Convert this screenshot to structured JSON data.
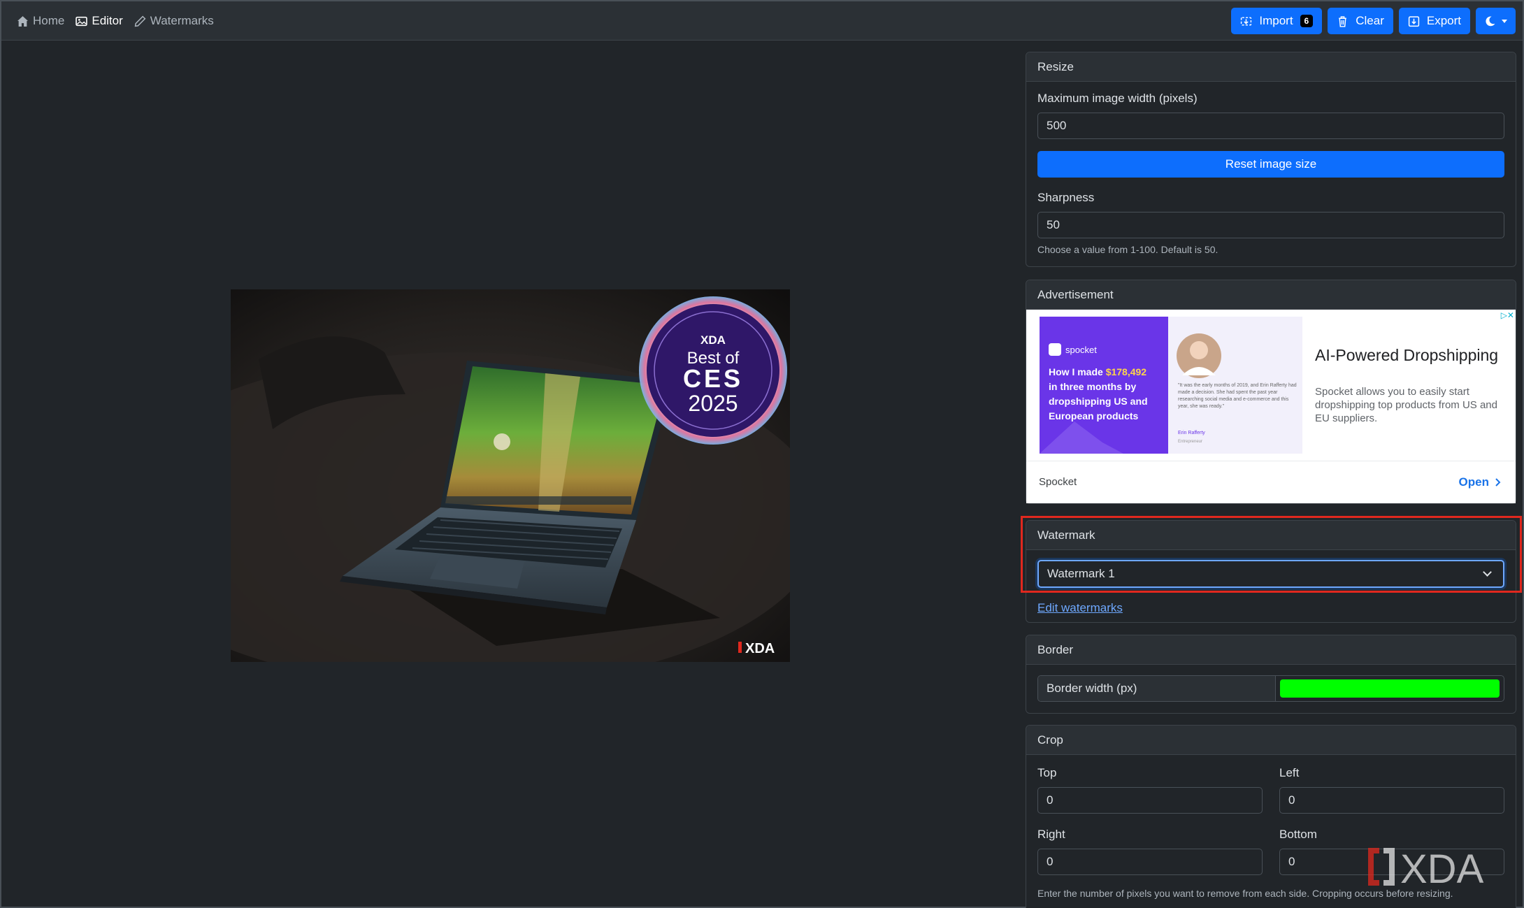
{
  "nav": {
    "home": "Home",
    "editor": "Editor",
    "watermarks": "Watermarks"
  },
  "actions": {
    "import_label": "Import",
    "import_count": "6",
    "clear_label": "Clear",
    "export_label": "Export"
  },
  "preview": {
    "badge_brand": "XDA",
    "badge_line1": "Best of",
    "badge_line2": "CES",
    "badge_line3": "2025",
    "corner_mark": "XDA"
  },
  "resize": {
    "header": "Resize",
    "width_label": "Maximum image width (pixels)",
    "width_value": "500",
    "reset_button": "Reset image size",
    "sharpness_label": "Sharpness",
    "sharpness_value": "50",
    "sharpness_help": "Choose a value from 1-100. Default is 50."
  },
  "ad": {
    "header": "Advertisement",
    "creative_brand": "spocket",
    "creative_headline_pre": "How I made ",
    "creative_headline_amount": "$178,492",
    "creative_headline_post": " in three months by dropshipping US and European products",
    "creative_quote": "\"It was the early months of 2019, and Erin Rafferty had made a decision. She had spent the past year researching social media and e-commerce and this year, she was ready.\"",
    "creative_person": "Erin Rafferty",
    "creative_role": "Entrepreneur",
    "title": "AI-Powered Dropshipping",
    "description": "Spocket allows you to easily start dropshipping top products from US and EU suppliers.",
    "advertiser": "Spocket",
    "cta": "Open"
  },
  "watermark": {
    "header": "Watermark",
    "selected": "Watermark 1",
    "edit_link": "Edit watermarks"
  },
  "border": {
    "header": "Border",
    "width_label": "Border width (px)",
    "color": "#00ff00"
  },
  "crop": {
    "header": "Crop",
    "top_label": "Top",
    "top_value": "0",
    "left_label": "Left",
    "left_value": "0",
    "right_label": "Right",
    "right_value": "0",
    "bottom_label": "Bottom",
    "bottom_value": "0",
    "help": "Enter the number of pixels you want to remove from each side. Cropping occurs before resizing."
  },
  "overlay_mark": "XDA",
  "colors": {
    "primary": "#0d6efd",
    "highlight": "#e0281e",
    "background": "#212529"
  }
}
